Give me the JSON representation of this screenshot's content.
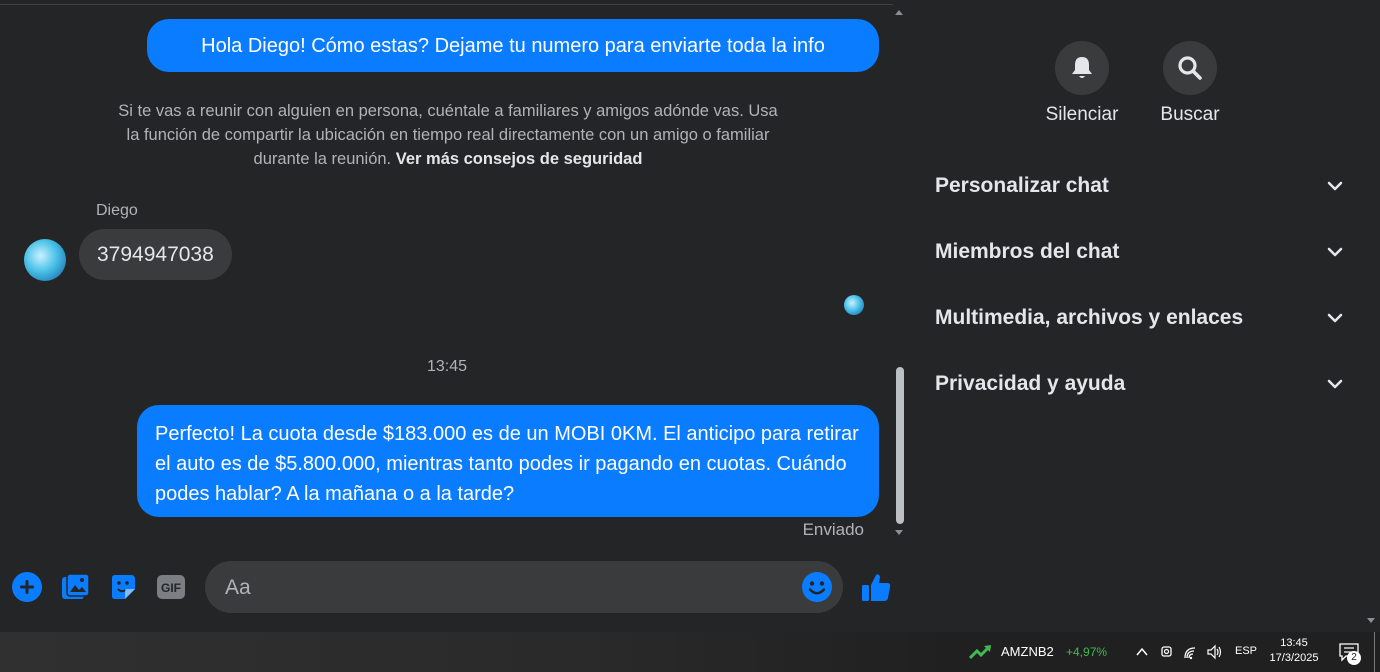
{
  "chat": {
    "messages": {
      "outgoing_1": "Hola Diego! Cómo estas? Dejame tu numero para enviarte toda la info",
      "safety_text": "Si te vas a reunir con alguien en persona, cuéntale a familiares y amigos adónde vas. Usa la función de compartir la ubicación en tiempo real directamente con un amigo o familiar durante la reunión.",
      "safety_link": "Ver más consejos de seguridad",
      "sender_name": "Diego",
      "incoming_1": "3794947038",
      "timestamp": "13:45",
      "outgoing_2": "Perfecto! La cuota desde $183.000 es de un MOBI 0KM. El anticipo para retirar el auto es de $5.800.000, mientras tanto podes ir pagando en cuotas. Cuándo podes hablar? A la mañana o a la tarde?",
      "status": "Enviado"
    },
    "composer": {
      "placeholder": "Aa",
      "icons": [
        "plus-icon",
        "image-icon",
        "sticker-icon",
        "gif-icon",
        "emoji-icon",
        "like-icon"
      ],
      "gif_label": "GIF"
    }
  },
  "panel": {
    "actions": [
      {
        "label": "Silenciar",
        "icon": "bell-icon"
      },
      {
        "label": "Buscar",
        "icon": "search-icon"
      }
    ],
    "sections": [
      {
        "label": "Personalizar chat"
      },
      {
        "label": "Miembros del chat"
      },
      {
        "label": "Multimedia, archivos y enlaces"
      },
      {
        "label": "Privacidad y ayuda"
      }
    ]
  },
  "taskbar": {
    "stock_name": "AMZNB2",
    "stock_change": "+4,97%",
    "language": "ESP",
    "time": "13:45",
    "date": "17/3/2025",
    "notification_count": "2"
  },
  "colors": {
    "accent": "#0a7cff",
    "background": "#242526",
    "bubble_in": "#3a3b3c",
    "stock_up": "#3fb950"
  }
}
